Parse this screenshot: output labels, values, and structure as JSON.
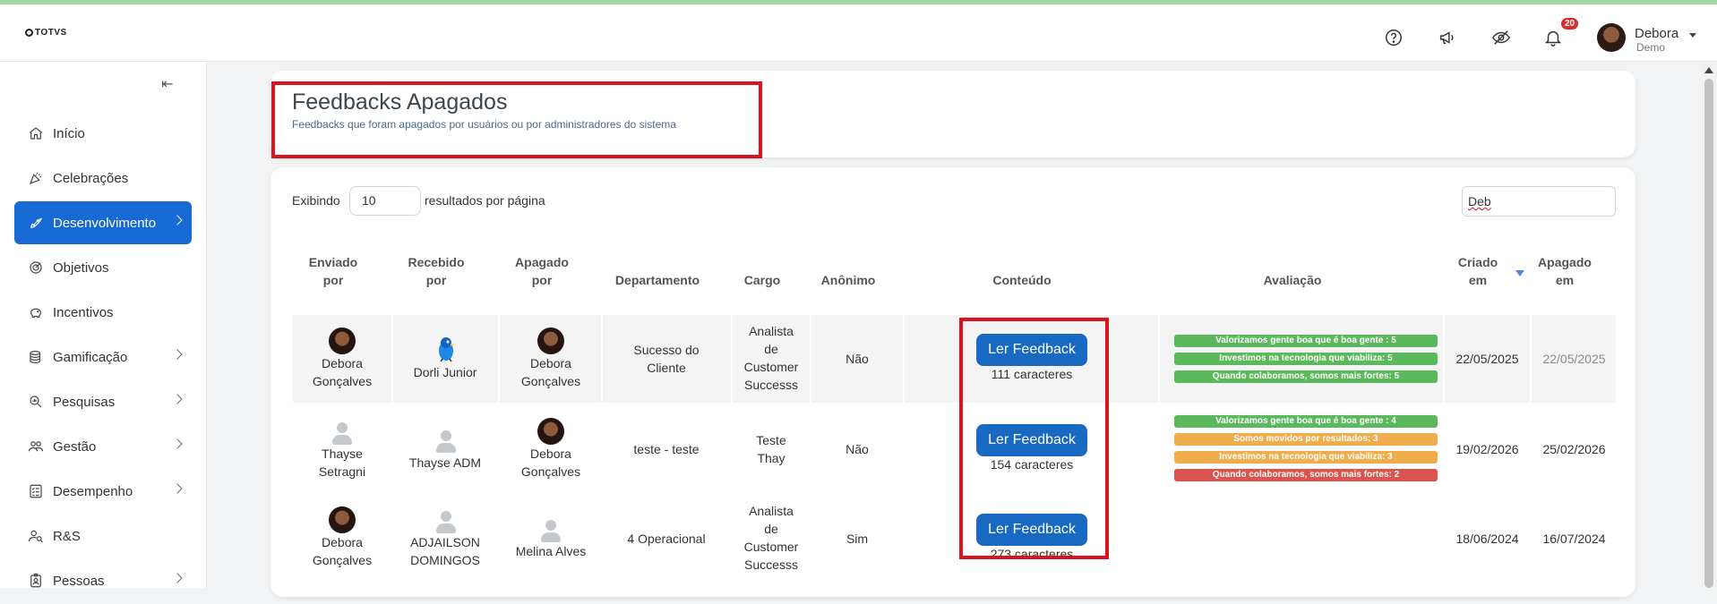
{
  "header": {
    "logo": "TOTVS",
    "notification_count": "20",
    "user_name": "Debora",
    "user_role": "Demo"
  },
  "sidebar": {
    "items": [
      {
        "label": "Início",
        "icon": "home-icon"
      },
      {
        "label": "Celebrações",
        "icon": "party-icon"
      },
      {
        "label": "Desenvolvimento",
        "icon": "rocket-icon"
      },
      {
        "label": "Objetivos",
        "icon": "target-icon"
      },
      {
        "label": "Incentivos",
        "icon": "piggy-bank-icon"
      },
      {
        "label": "Gamificação",
        "icon": "coins-icon"
      },
      {
        "label": "Pesquisas",
        "icon": "search-chart-icon"
      },
      {
        "label": "Gestão",
        "icon": "users-icon"
      },
      {
        "label": "Desempenho",
        "icon": "checklist-icon"
      },
      {
        "label": "R&S",
        "icon": "user-search-icon"
      },
      {
        "label": "Pessoas",
        "icon": "id-badge-icon"
      }
    ]
  },
  "page": {
    "title": "Feedbacks Apagados",
    "subtitle": "Feedbacks que foram apagados por usuários ou por administradores do sistema"
  },
  "table_controls": {
    "showing_label": "Exibindo",
    "per_page_value": "10",
    "per_page_suffix": "resultados por página",
    "search_value": "Deb"
  },
  "columns": {
    "enviado": [
      "Enviado",
      "por"
    ],
    "recebido": [
      "Recebido",
      "por"
    ],
    "apagado": [
      "Apagado",
      "por"
    ],
    "departamento": "Departamento",
    "cargo": "Cargo",
    "anonimo": "Anônimo",
    "conteudo": "Conteúdo",
    "avaliacao": "Avaliação",
    "criado": [
      "Criado",
      "em"
    ],
    "apagado_em": [
      "Apagado",
      "em"
    ]
  },
  "rows": [
    {
      "enviado": [
        "Debora",
        "Gonçalves"
      ],
      "recebido": [
        "Dorli Junior"
      ],
      "apagado": [
        "Debora",
        "Gonçalves"
      ],
      "departamento": [
        "Sucesso do",
        "Cliente"
      ],
      "cargo": [
        "Analista",
        "de",
        "Customer",
        "Successs"
      ],
      "anonimo": "Não",
      "button": "Ler Feedback",
      "chars": "111 caracteres",
      "avaliacao": [
        "Valorizamos gente boa que é boa gente : 5",
        "Investimos na tecnologia que viabiliza: 5",
        "Quando colaboramos, somos mais fortes: 5"
      ],
      "criado": "22/05/2025",
      "apagado_em": "22/05/2025"
    },
    {
      "enviado": [
        "Thayse",
        "Setragni"
      ],
      "recebido": [
        "Thayse ADM"
      ],
      "apagado": [
        "Debora",
        "Gonçalves"
      ],
      "departamento": [
        "teste - teste"
      ],
      "cargo": [
        "Teste",
        "Thay"
      ],
      "anonimo": "Não",
      "button": "Ler Feedback",
      "chars": "154 caracteres",
      "avaliacao": [
        "Valorizamos gente boa que é boa gente : 4",
        "Somos movidos por resultados: 3",
        "Investimos na tecnologia que viabiliza: 3",
        "Quando colaboramos, somos mais fortes: 2"
      ],
      "criado": "19/02/2026",
      "apagado_em": "25/02/2026"
    },
    {
      "enviado": [
        "Debora",
        "Gonçalves"
      ],
      "recebido": [
        "ADJAILSON",
        "DOMINGOS"
      ],
      "apagado": [
        "Melina Alves"
      ],
      "departamento": [
        "4 Operacional"
      ],
      "cargo": [
        "Analista",
        "de",
        "Customer",
        "Successs"
      ],
      "anonimo": "Sim",
      "button": "Ler Feedback",
      "chars": "273 caracteres",
      "avaliacao": [],
      "criado": "18/06/2024",
      "apagado_em": "16/07/2024"
    }
  ],
  "colors": {
    "primary": "#1769d3",
    "highlight_box": "#d9141e",
    "pill_green": "#5cb85c",
    "pill_orange": "#f0ad4e",
    "pill_red": "#d9534f"
  }
}
